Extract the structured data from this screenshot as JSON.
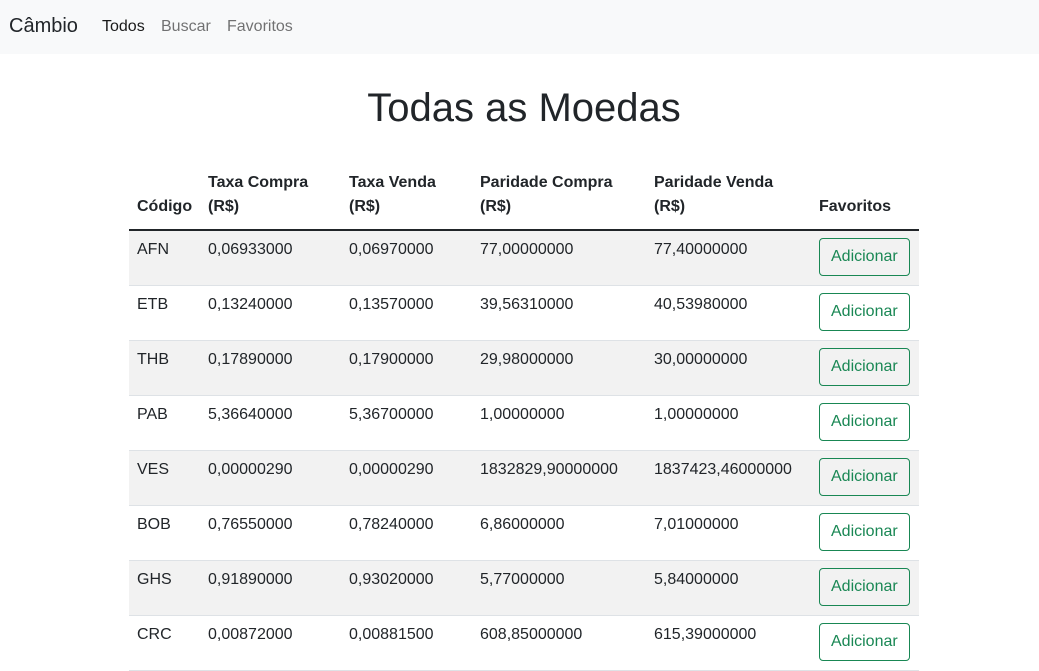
{
  "navbar": {
    "brand": "Câmbio",
    "links": [
      {
        "label": "Todos",
        "active": true
      },
      {
        "label": "Buscar",
        "active": false
      },
      {
        "label": "Favoritos",
        "active": false
      }
    ]
  },
  "page": {
    "title": "Todas as Moedas"
  },
  "table": {
    "headers": {
      "code": "Código",
      "taxa_compra_line1": "Taxa Compra",
      "taxa_compra_line2": "(R$)",
      "taxa_venda_line1": "Taxa Venda",
      "taxa_venda_line2": "(R$)",
      "paridade_compra_line1": "Paridade Compra",
      "paridade_compra_line2": "(R$)",
      "paridade_venda_line1": "Paridade Venda",
      "paridade_venda_line2": "(R$)",
      "favoritos": "Favoritos"
    },
    "add_label": "Adicionar",
    "rows": [
      {
        "code": "AFN",
        "taxa_compra": "0,06933000",
        "taxa_venda": "0,06970000",
        "paridade_compra": "77,00000000",
        "paridade_venda": "77,40000000"
      },
      {
        "code": "ETB",
        "taxa_compra": "0,13240000",
        "taxa_venda": "0,13570000",
        "paridade_compra": "39,56310000",
        "paridade_venda": "40,53980000"
      },
      {
        "code": "THB",
        "taxa_compra": "0,17890000",
        "taxa_venda": "0,17900000",
        "paridade_compra": "29,98000000",
        "paridade_venda": "30,00000000"
      },
      {
        "code": "PAB",
        "taxa_compra": "5,36640000",
        "taxa_venda": "5,36700000",
        "paridade_compra": "1,00000000",
        "paridade_venda": "1,00000000"
      },
      {
        "code": "VES",
        "taxa_compra": "0,00000290",
        "taxa_venda": "0,00000290",
        "paridade_compra": "1832829,90000000",
        "paridade_venda": "1837423,46000000"
      },
      {
        "code": "BOB",
        "taxa_compra": "0,76550000",
        "taxa_venda": "0,78240000",
        "paridade_compra": "6,86000000",
        "paridade_venda": "7,01000000"
      },
      {
        "code": "GHS",
        "taxa_compra": "0,91890000",
        "taxa_venda": "0,93020000",
        "paridade_compra": "5,77000000",
        "paridade_venda": "5,84000000"
      },
      {
        "code": "CRC",
        "taxa_compra": "0,00872000",
        "taxa_venda": "0,00881500",
        "paridade_compra": "608,85000000",
        "paridade_venda": "615,39000000"
      }
    ]
  }
}
